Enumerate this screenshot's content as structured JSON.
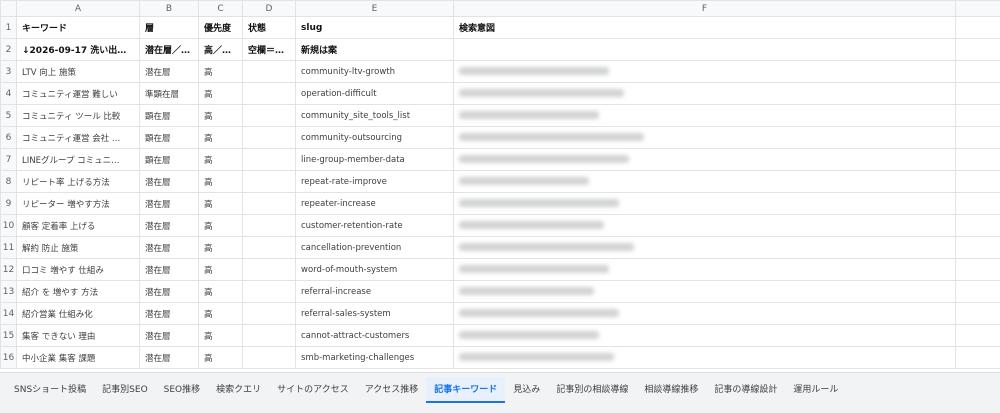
{
  "columns": [
    "A",
    "B",
    "C",
    "D",
    "E",
    "F"
  ],
  "header_row": {
    "num": "1",
    "cells": [
      "キーワード",
      "層",
      "優先度",
      "状態",
      "slug",
      "検索意図"
    ]
  },
  "note_row": {
    "num": "2",
    "cells": [
      "↓2026-09-17 洗い出…",
      "潜在層／…",
      "高／…",
      "空欄＝…",
      "新規は案",
      ""
    ]
  },
  "rows": [
    {
      "num": "3",
      "keyword": "LTV 向上 施策",
      "layer": "潜在層",
      "priority": "高",
      "status": "",
      "slug": "community-ltv-growth"
    },
    {
      "num": "4",
      "keyword": "コミュニティ運営 難しい",
      "layer": "準顕在層",
      "priority": "高",
      "status": "",
      "slug": "operation-difficult"
    },
    {
      "num": "5",
      "keyword": "コミュニティ ツール 比較",
      "layer": "顕在層",
      "priority": "高",
      "status": "",
      "slug": "community_site_tools_list"
    },
    {
      "num": "6",
      "keyword": "コミュニティ運営 会社 …",
      "layer": "顕在層",
      "priority": "高",
      "status": "",
      "slug": "community-outsourcing"
    },
    {
      "num": "7",
      "keyword": "LINEグループ コミュニ…",
      "layer": "顕在層",
      "priority": "高",
      "status": "",
      "slug": "line-group-member-data"
    },
    {
      "num": "8",
      "keyword": "リピート率 上げる方法",
      "layer": "潜在層",
      "priority": "高",
      "status": "",
      "slug": "repeat-rate-improve"
    },
    {
      "num": "9",
      "keyword": "リピーター 増やす方法",
      "layer": "潜在層",
      "priority": "高",
      "status": "",
      "slug": "repeater-increase"
    },
    {
      "num": "10",
      "keyword": "顧客 定着率 上げる",
      "layer": "潜在層",
      "priority": "高",
      "status": "",
      "slug": "customer-retention-rate"
    },
    {
      "num": "11",
      "keyword": "解約 防止 施策",
      "layer": "潜在層",
      "priority": "高",
      "status": "",
      "slug": "cancellation-prevention"
    },
    {
      "num": "12",
      "keyword": "口コミ 増やす 仕組み",
      "layer": "潜在層",
      "priority": "高",
      "status": "",
      "slug": "word-of-mouth-system"
    },
    {
      "num": "13",
      "keyword": "紹介 を 増やす 方法",
      "layer": "潜在層",
      "priority": "高",
      "status": "",
      "slug": "referral-increase"
    },
    {
      "num": "14",
      "keyword": "紹介営業 仕組み化",
      "layer": "潜在層",
      "priority": "高",
      "status": "",
      "slug": "referral-sales-system"
    },
    {
      "num": "15",
      "keyword": "集客 できない 理由",
      "layer": "潜在層",
      "priority": "高",
      "status": "",
      "slug": "cannot-attract-customers"
    },
    {
      "num": "16",
      "keyword": "中小企業 集客 課題",
      "layer": "潜在層",
      "priority": "高",
      "status": "",
      "slug": "smb-marketing-challenges"
    }
  ],
  "sheet_tabs": [
    {
      "label": "SNSショート投稿"
    },
    {
      "label": "記事別SEO"
    },
    {
      "label": "SEO推移"
    },
    {
      "label": "検索クエリ"
    },
    {
      "label": "サイトのアクセス"
    },
    {
      "label": "アクセス推移"
    },
    {
      "label": "記事キーワード",
      "active": true
    },
    {
      "label": "見込み"
    },
    {
      "label": "記事別の相談導線"
    },
    {
      "label": "相談導線推移"
    },
    {
      "label": "記事の導線設計"
    },
    {
      "label": "運用ルール"
    }
  ],
  "colors": {
    "active_tab": "#1a73e8",
    "header_bg": "#f8f9fa",
    "gridline": "#e2e3e3"
  }
}
